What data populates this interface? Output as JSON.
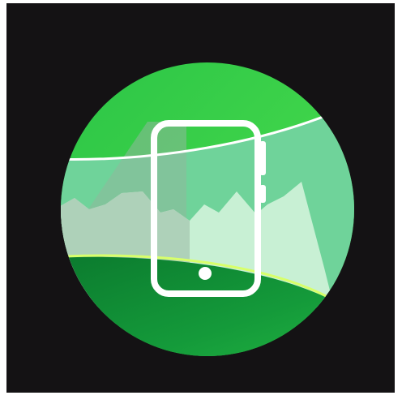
{
  "app_icon": {
    "icon": "phone-landscape-icon",
    "colors": {
      "background": "#141214",
      "circle_light": "#3fd44a",
      "circle_mid": "#21b33c",
      "circle_dark": "#0b7a2e",
      "sky_band": "#6fd39a",
      "mountain_light": "#c8f0d4",
      "mountain_shadow": "#a9cbb4",
      "horizon_glow": "#d8ff6a",
      "outline": "#ffffff"
    }
  }
}
